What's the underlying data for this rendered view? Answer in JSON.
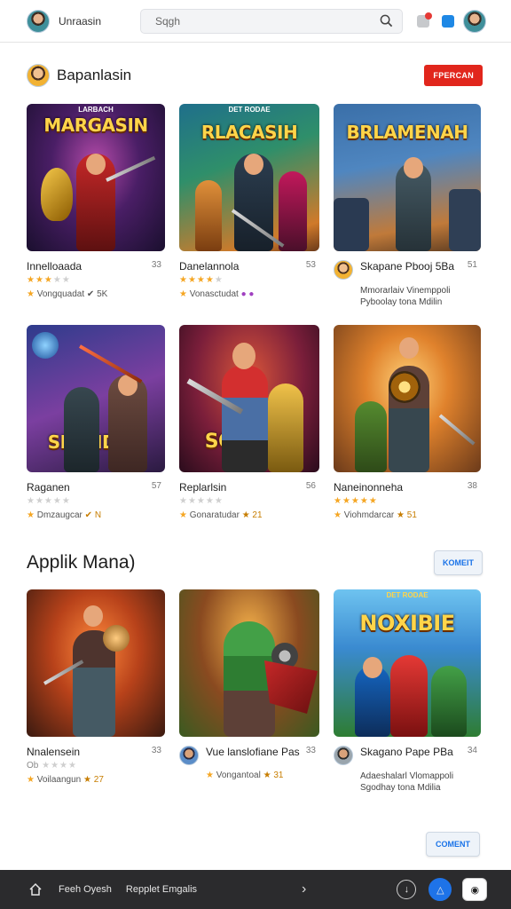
{
  "header": {
    "app_title": "Unraasin",
    "search_placeholder": "Sqgh",
    "icons": [
      "user-avatar",
      "search-icon",
      "notification-icon",
      "message-icon",
      "profile-avatar"
    ]
  },
  "section1": {
    "title": "Bapanlasin",
    "button": "FPERCAN",
    "games": [
      {
        "title": "Innelloaada",
        "count": "33",
        "rating": 3,
        "sub": "Vongquadat",
        "sub_icons": "✔ 5K",
        "banner": "MARGASIN",
        "tag": "LARBACH"
      },
      {
        "title": "Danelannola",
        "count": "53",
        "rating": 4,
        "sub": "Vonasctudat",
        "sub_icons": "● ●",
        "banner": "RLACASIH",
        "tag": "DET RODAE"
      },
      {
        "title": "Skapane Pbooj 5Ba",
        "count": "51",
        "desc": "Mmorarlaiv Vinemppoli Pyboolay tona Mdilin",
        "banner": "BRLAMENAH",
        "tag": "",
        "has_avatar": true
      },
      {
        "title": "Raganen",
        "count": "57",
        "rating": 0,
        "sub": "Dmzaugcar",
        "sub_icons": "✔ N",
        "banner": "SHRNDAN",
        "tag": ""
      },
      {
        "title": "Replarlsin",
        "count": "56",
        "rating": 0,
        "sub": "Gonaratudar",
        "sub_icons": "★ 21",
        "banner": "SOANDS",
        "tag": ""
      },
      {
        "title": "Naneinonneha",
        "count": "38",
        "rating": 5,
        "sub": "Viohmdarcar",
        "sub_icons": "★ 51",
        "banner": "",
        "tag": ""
      }
    ]
  },
  "section2": {
    "title": "Applik Mana)",
    "button": "KOMEIT",
    "games": [
      {
        "title": "Nnalensein",
        "count": "33",
        "rating": 0,
        "sub": "Voilaangun",
        "sub_icons": "★ 27",
        "prefix": "Ob",
        "banner": "",
        "tag": ""
      },
      {
        "title": "Vue lanslofiane Pas",
        "count": "33",
        "rating": 0,
        "sub": "Vongantoal",
        "sub_icons": "★ 31",
        "banner": "",
        "tag": "",
        "has_avatar": true
      },
      {
        "title": "Skagano Pape PBa",
        "count": "34",
        "desc": "Adaeshalarl Vlomappoli Sgodhay tona Mdilia",
        "banner": "NOXIBIE",
        "tag": "DET RODAE",
        "has_avatar": true
      }
    ]
  },
  "footer_button": "COMENT",
  "bottom_nav": {
    "label1": "Feeh Oyesh",
    "label2": "Repplet Emgalis"
  },
  "colors": {
    "accent_red": "#e1261c",
    "accent_blue": "#1e73e8",
    "star": "#f5a623"
  }
}
